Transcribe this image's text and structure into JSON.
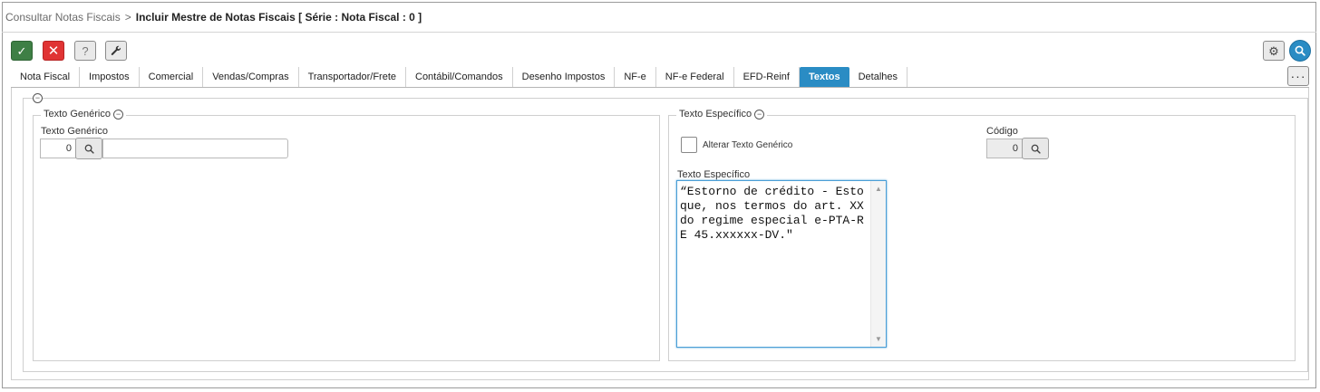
{
  "breadcrumb": {
    "parent": "Consultar Notas Fiscais",
    "separator": ">",
    "current": "Incluir Mestre de Notas Fiscais [ Série : Nota Fiscal : 0 ]"
  },
  "toolbar": {
    "confirm_icon": "check-icon",
    "cancel_icon": "close-icon",
    "help_label": "?",
    "tools_icon": "wrench-icon",
    "settings_icon": "gear-icon",
    "search_icon": "search-icon",
    "more_label": "···"
  },
  "tabs": [
    {
      "label": "Nota Fiscal",
      "active": false
    },
    {
      "label": "Impostos",
      "active": false
    },
    {
      "label": "Comercial",
      "active": false
    },
    {
      "label": "Vendas/Compras",
      "active": false
    },
    {
      "label": "Transportador/Frete",
      "active": false
    },
    {
      "label": "Contábil/Comandos",
      "active": false
    },
    {
      "label": "Desenho Impostos",
      "active": false
    },
    {
      "label": "NF-e",
      "active": false
    },
    {
      "label": "NF-e Federal",
      "active": false
    },
    {
      "label": "EFD-Reinf",
      "active": false
    },
    {
      "label": "Textos",
      "active": true
    },
    {
      "label": "Detalhes",
      "active": false
    }
  ],
  "texto_generico": {
    "legend": "Texto Genérico",
    "field_label": "Texto Genérico",
    "code_value": "0",
    "description_value": ""
  },
  "texto_especifico": {
    "legend": "Texto Específico",
    "checkbox_label": "Alterar Texto Genérico",
    "checkbox_checked": false,
    "codigo_label": "Código",
    "codigo_value": "0",
    "textarea_label": "Texto Específico",
    "textarea_value": "“Estorno de crédito - Estoque, nos termos do art. XX do regime especial e-PTA-RE 45.xxxxxx-DV.\""
  },
  "colors": {
    "accent": "#2a8cc4",
    "confirm": "#3e7f45",
    "cancel": "#e03434"
  }
}
